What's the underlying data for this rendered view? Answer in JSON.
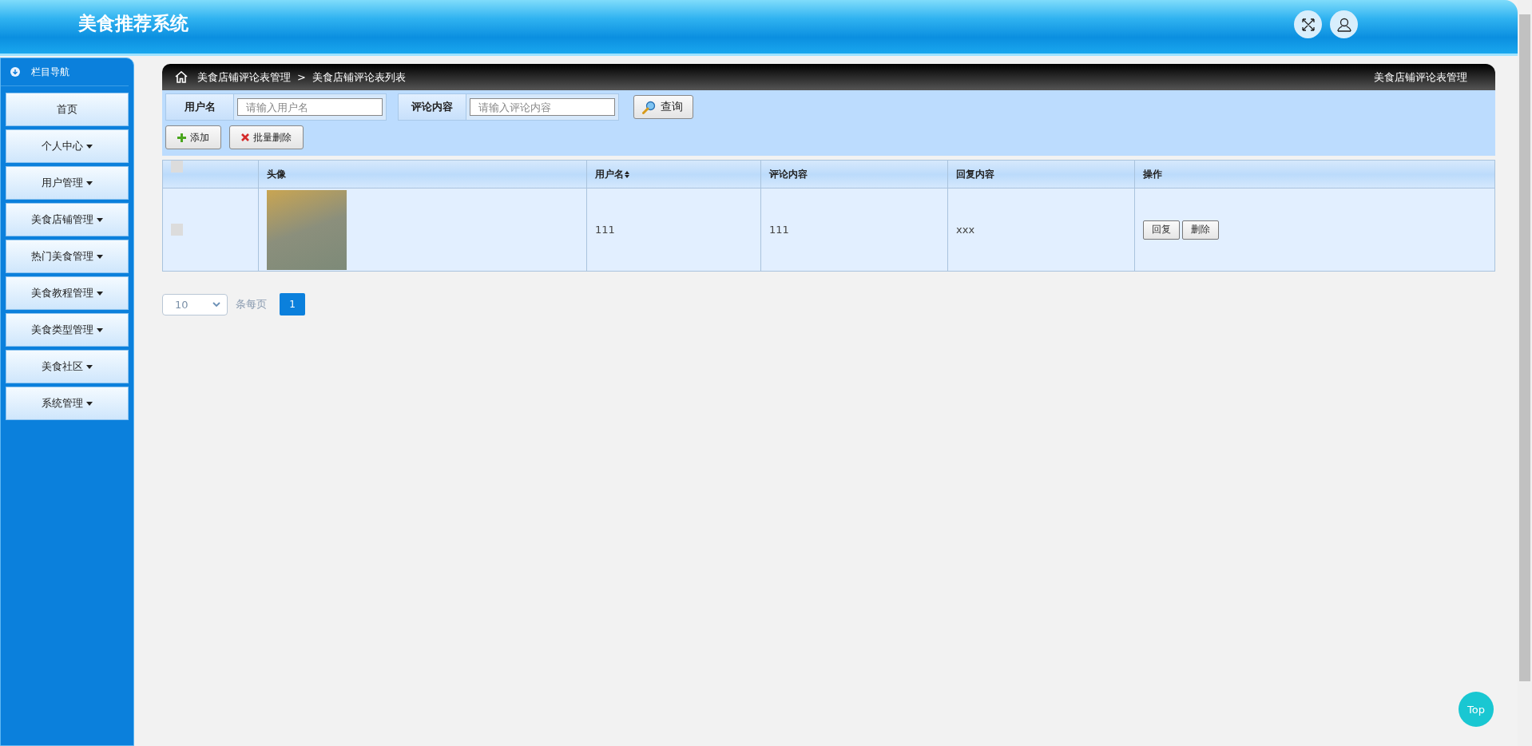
{
  "header": {
    "title": "美食推荐系统"
  },
  "sidebar": {
    "title": "栏目导航",
    "items": [
      {
        "label": "首页",
        "has_menu": false
      },
      {
        "label": "个人中心",
        "has_menu": true
      },
      {
        "label": "用户管理",
        "has_menu": true
      },
      {
        "label": "美食店铺管理",
        "has_menu": true
      },
      {
        "label": "热门美食管理",
        "has_menu": true
      },
      {
        "label": "美食教程管理",
        "has_menu": true
      },
      {
        "label": "美食类型管理",
        "has_menu": true
      },
      {
        "label": "美食社区",
        "has_menu": true
      },
      {
        "label": "系统管理",
        "has_menu": true
      }
    ]
  },
  "breadcrumb": {
    "items": [
      "美食店铺评论表管理",
      "美食店铺评论表列表"
    ],
    "separator": ">",
    "page_title": "美食店铺评论表管理"
  },
  "search": {
    "fields": [
      {
        "label": "用户名",
        "placeholder": "请输入用户名"
      },
      {
        "label": "评论内容",
        "placeholder": "请输入评论内容"
      }
    ],
    "button": "查询"
  },
  "actions": [
    {
      "kind": "add",
      "label": "添加"
    },
    {
      "kind": "delete",
      "label": "批量删除"
    }
  ],
  "table": {
    "columns": [
      {
        "label": "头像",
        "sortable": false
      },
      {
        "label": "用户名",
        "sortable": true
      },
      {
        "label": "评论内容",
        "sortable": false
      },
      {
        "label": "回复内容",
        "sortable": false
      },
      {
        "label": "操作",
        "sortable": false
      }
    ],
    "header_checked": false,
    "rows": [
      {
        "checked": false,
        "username": "111",
        "comment": "111",
        "reply": "xxx",
        "buttons": [
          "回复",
          "删除"
        ]
      }
    ]
  },
  "pagination": {
    "page_size": "10",
    "per_page_label": "条每页",
    "pages": [
      {
        "label": "1",
        "selected": true
      }
    ]
  },
  "top_button": "Top"
}
